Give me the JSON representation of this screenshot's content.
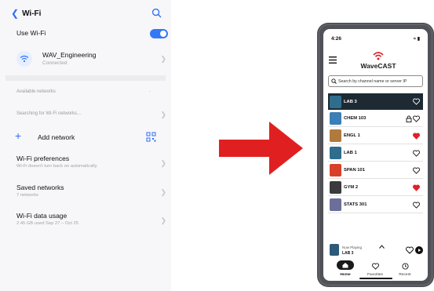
{
  "wifi_settings": {
    "title": "Wi-Fi",
    "use_wifi_label": "Use Wi-Fi",
    "use_wifi_enabled": true,
    "connected_network": {
      "name": "WAV_Engineering",
      "status": "Connected"
    },
    "available_networks_label": "Available networks",
    "searching_label": "Searching for Wi-Fi networks...",
    "add_network_label": "Add network",
    "preferences": {
      "title": "Wi-Fi preferences",
      "subtitle": "Wi-Fi doesn't turn back on automatically"
    },
    "saved_networks": {
      "title": "Saved networks",
      "subtitle": "7 networks"
    },
    "data_usage": {
      "title": "Wi-Fi data usage",
      "subtitle": "2.45 GB used Sep 27 – Oct 25"
    }
  },
  "arrow": {
    "color": "#e02020",
    "icon": "right-arrow"
  },
  "wavecast_app": {
    "status_time": "4:26",
    "logo_text": "WaveCAST",
    "search_placeholder": "Search by channel name or server IP",
    "channels": [
      {
        "name": "LAB 3",
        "favorite": false,
        "locked": false,
        "selected": true,
        "thumb_color": "#2f6d8f"
      },
      {
        "name": "CHEM 103",
        "favorite": false,
        "locked": true,
        "selected": false,
        "thumb_color": "#3a7fb5"
      },
      {
        "name": "ENGL 1",
        "favorite": true,
        "locked": false,
        "selected": false,
        "thumb_color": "#b07a3c"
      },
      {
        "name": "LAB 1",
        "favorite": false,
        "locked": false,
        "selected": false,
        "thumb_color": "#2f6d8f"
      },
      {
        "name": "SPAN 101",
        "favorite": false,
        "locked": false,
        "selected": false,
        "thumb_color": "#d8402a"
      },
      {
        "name": "GYM 2",
        "favorite": true,
        "locked": false,
        "selected": false,
        "thumb_color": "#3b3b3b"
      },
      {
        "name": "STATS 301",
        "favorite": false,
        "locked": false,
        "selected": false,
        "thumb_color": "#6b6f9a"
      }
    ],
    "now_playing": {
      "label": "Now Playing",
      "channel": "LAB 3"
    },
    "tabs": [
      {
        "label": "Home",
        "icon": "home-icon",
        "active": true
      },
      {
        "label": "Favorites",
        "icon": "heart-icon",
        "active": false
      },
      {
        "label": "Recent",
        "icon": "clock-icon",
        "active": false
      }
    ],
    "favorite_color": "#e0202a"
  }
}
